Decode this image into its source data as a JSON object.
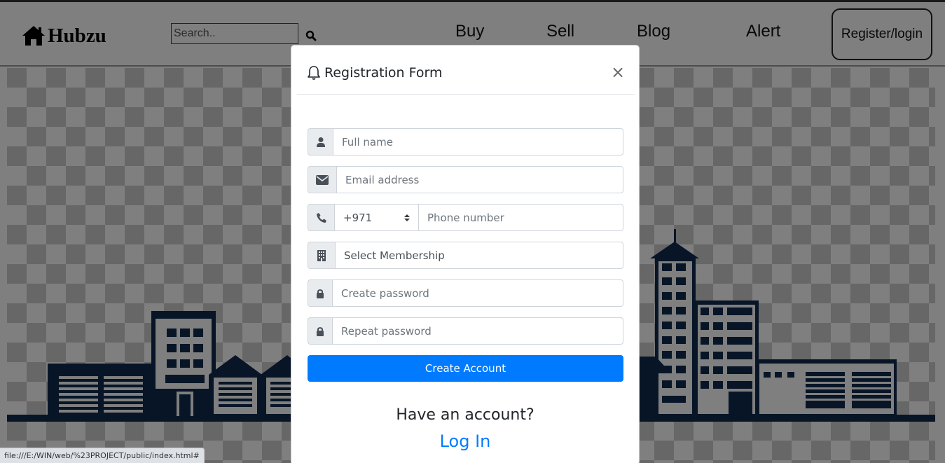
{
  "navbar": {
    "brand": "Hubzu",
    "search_placeholder": "Search..",
    "links": [
      "Buy",
      "Sell",
      "Blog",
      "Alert"
    ],
    "register_label": "Register/login"
  },
  "modal": {
    "title": "Registration Form",
    "close_label": "×",
    "fields": {
      "full_name_placeholder": "Full name",
      "email_placeholder": "Email address",
      "country_code": "+971",
      "phone_placeholder": "Phone number",
      "membership_selected": "Select Membership",
      "password_placeholder": "Create password",
      "repeat_password_placeholder": "Repeat password"
    },
    "submit_label": "Create Account",
    "have_account_text": "Have an account?",
    "login_label": "Log In"
  },
  "status_bar": {
    "url": "file:///E:/WIN/web/%23PROJECT/public/index.html#"
  },
  "colors": {
    "primary": "#007bff",
    "city_navy": "#0f2a4e",
    "backdrop": "rgba(0,0,0,0.5)"
  }
}
